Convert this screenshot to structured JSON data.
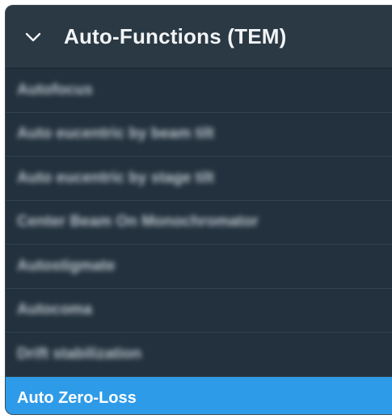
{
  "panel": {
    "title": "Auto-Functions (TEM)",
    "expand_icon": "chevron-down-icon",
    "items": [
      {
        "label": "Autofocus",
        "blurred": true
      },
      {
        "label": "Auto eucentric by beam tilt",
        "blurred": true
      },
      {
        "label": "Auto eucentric by stage tilt",
        "blurred": true
      },
      {
        "label": "Center Beam On Monochromator",
        "blurred": true
      },
      {
        "label": "Autostigmate",
        "blurred": true
      },
      {
        "label": "Autocoma",
        "blurred": true
      },
      {
        "label": "Drift stabilization",
        "blurred": true
      },
      {
        "label": "Auto Zero-Loss",
        "blurred": false,
        "selected": true
      }
    ]
  },
  "colors": {
    "panel_bg": "#22313d",
    "header_bg": "#2b3944",
    "selected_bg": "#2e9be8",
    "text": "#f2f4f6"
  }
}
